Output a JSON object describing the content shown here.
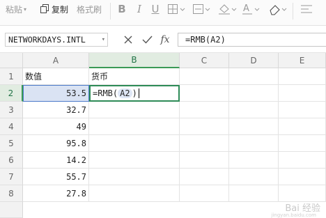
{
  "ribbon": {
    "paste_label": "粘贴",
    "copy_label": "复制",
    "format_painter_label": "格式刷"
  },
  "formula_bar": {
    "name_box": "NETWORKDAYS.INTL",
    "cancel_icon": "close-icon",
    "confirm_icon": "check-icon",
    "fx_label": "fx",
    "formula": "=RMB(A2)"
  },
  "columns": [
    "A",
    "B",
    "C",
    "D",
    "E"
  ],
  "rows": [
    {
      "num": "1",
      "a": "数值",
      "b": "货币"
    },
    {
      "num": "2",
      "a": "53.5",
      "b_prefix": "=RMB(",
      "b_ref": "A2",
      "b_suffix": ")"
    },
    {
      "num": "3",
      "a": "32.7",
      "b": ""
    },
    {
      "num": "4",
      "a": "49",
      "b": ""
    },
    {
      "num": "5",
      "a": "95.8",
      "b": ""
    },
    {
      "num": "6",
      "a": "14.2",
      "b": ""
    },
    {
      "num": "7",
      "a": "55.7",
      "b": ""
    },
    {
      "num": "8",
      "a": "27.8",
      "b": ""
    }
  ],
  "watermark": "Bai 经验",
  "watermark_sub": "jingyan.baidu.com"
}
